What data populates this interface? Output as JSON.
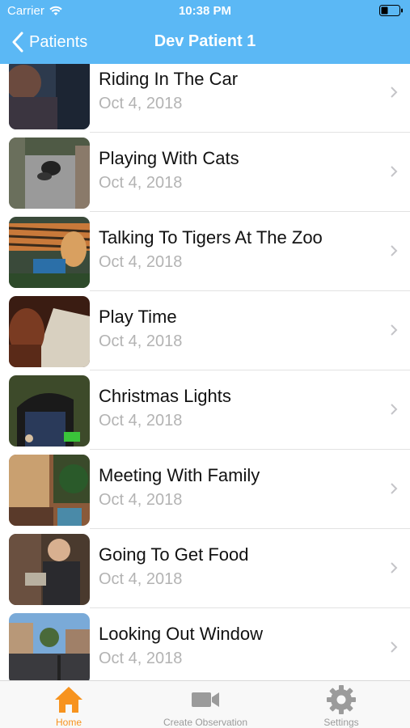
{
  "status_bar": {
    "carrier": "Carrier",
    "time": "10:38 PM"
  },
  "nav": {
    "back_label": "Patients",
    "title": "Dev Patient 1"
  },
  "observations": [
    {
      "title": "Riding In The Car",
      "date": "Oct 4, 2018"
    },
    {
      "title": "Playing With Cats",
      "date": "Oct 4, 2018"
    },
    {
      "title": "Talking To Tigers At The Zoo",
      "date": "Oct 4, 2018"
    },
    {
      "title": "Play Time",
      "date": "Oct 4, 2018"
    },
    {
      "title": "Christmas Lights",
      "date": "Oct 4, 2018"
    },
    {
      "title": "Meeting With Family",
      "date": "Oct 4, 2018"
    },
    {
      "title": "Going To Get Food",
      "date": "Oct 4, 2018"
    },
    {
      "title": "Looking Out Window",
      "date": "Oct 4, 2018"
    }
  ],
  "tabbar": {
    "home_label": "Home",
    "create_label": "Create Observation",
    "settings_label": "Settings",
    "active_tab": "Home"
  },
  "colors": {
    "header_bg": "#5bb8f5",
    "tab_active": "#f7931e",
    "tab_inactive": "#9b9b9b"
  }
}
